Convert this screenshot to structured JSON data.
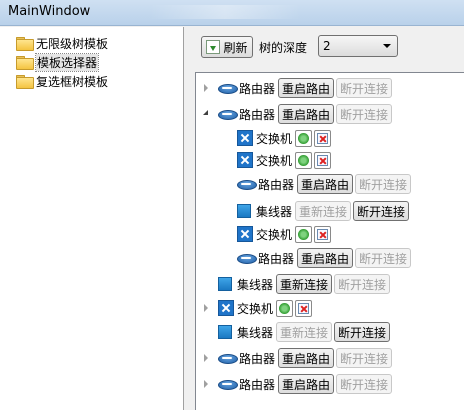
{
  "window": {
    "title": "MainWindow"
  },
  "left_tree": {
    "items": [
      {
        "label": "无限级树模板"
      },
      {
        "label": "模板选择器",
        "selected": true
      },
      {
        "label": "复选框树模板"
      }
    ]
  },
  "toolbar": {
    "refresh_label": "刷新",
    "depth_label": "树的深度",
    "depth_value": "2"
  },
  "tree": {
    "r1": {
      "label": "路由器",
      "b1": "重启路由",
      "b2": "断开连接"
    },
    "r2": {
      "label": "路由器",
      "b1": "重启路由",
      "b2": "断开连接"
    },
    "r3": {
      "label": "交换机"
    },
    "r4": {
      "label": "交换机"
    },
    "r5": {
      "label": "路由器",
      "b1": "重启路由",
      "b2": "断开连接"
    },
    "r6": {
      "label": "集线器",
      "b1": "重新连接",
      "b2": "断开连接"
    },
    "r7": {
      "label": "交换机"
    },
    "r8": {
      "label": "路由器",
      "b1": "重启路由",
      "b2": "断开连接"
    },
    "r9": {
      "label": "集线器",
      "b1": "重新连接",
      "b2": "断开连接"
    },
    "r10": {
      "label": "交换机"
    },
    "r11": {
      "label": "集线器",
      "b1": "重新连接",
      "b2": "断开连接"
    },
    "r12": {
      "label": "路由器",
      "b1": "重启路由",
      "b2": "断开连接"
    },
    "r13": {
      "label": "路由器",
      "b1": "重启路由",
      "b2": "断开连接"
    }
  }
}
